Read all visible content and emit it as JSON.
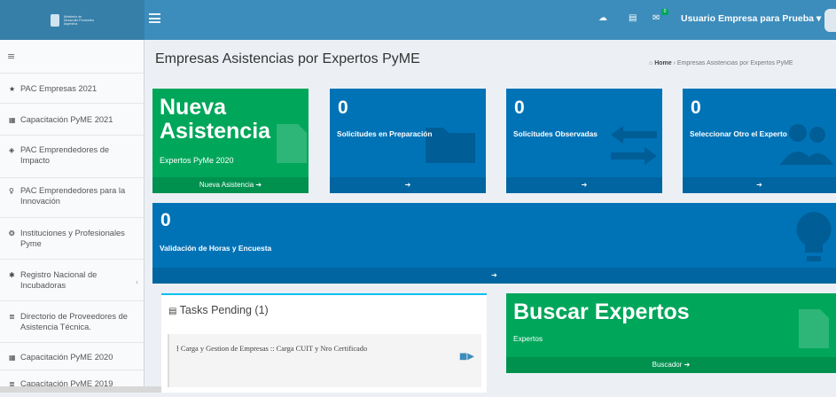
{
  "topbar": {
    "logo_text": [
      "Ministerio de",
      "Desarrollo Productivo",
      "Argentina"
    ],
    "user_label": "Usuario Empresa para Prueba ▾",
    "mail_badge": "0"
  },
  "sidebar": {
    "items": [
      {
        "icon": "★",
        "label": "PAC Empresas 2021"
      },
      {
        "icon": "▦",
        "label": "Capacitación PyME 2021"
      },
      {
        "icon": "◈",
        "label": "PAC Emprendedores de Impacto"
      },
      {
        "icon": "♀",
        "label": "PAC Emprendedores para la Innovación"
      },
      {
        "icon": "❂",
        "label": "Instituciones y Profesionales Pyme"
      },
      {
        "icon": "✱",
        "label": "Registro Nacional de Incubadoras"
      },
      {
        "icon": "≣",
        "label": "Directorio de Proveedores de Asistencia Técnica."
      },
      {
        "icon": "▦",
        "label": "Capacitación PyME 2020"
      },
      {
        "icon": "≣",
        "label": "Capacitación PyME 2019"
      }
    ]
  },
  "header": {
    "title": "Empresas Asistencias por Expertos PyME",
    "breadcrumb_home": "Home",
    "breadcrumb_current": "Empresas Asistencias por Expertos PyME"
  },
  "boxes": {
    "nueva": {
      "title": "Nueva Asistencia",
      "subtitle": "Expertos PyMe 2020",
      "footer": "Nueva Asistencia ➔"
    },
    "preparacion": {
      "value": "0",
      "label": "Solicitudes en Preparación",
      "footer": "➔"
    },
    "observadas": {
      "value": "0",
      "label": "Solicitudes Observadas",
      "footer": "➔"
    },
    "otro_experto": {
      "value": "0",
      "label": "Seleccionar Otro el Experto",
      "footer": "➔"
    },
    "validacion": {
      "value": "0",
      "label": "Validación de Horas y Encuesta",
      "footer": "➔"
    },
    "buscar": {
      "title": "Buscar Expertos",
      "subtitle": "Expertos",
      "footer": "Buscador ➔"
    }
  },
  "tasks": {
    "header": "Tasks Pending (1)",
    "items": [
      {
        "text": "Carga y Gestion de Empresas :: Carga CUIT y Nro Certificado"
      }
    ]
  },
  "colors": {
    "topbar": "#3c8dbc",
    "green": "#00a65a",
    "blue": "#0073b7"
  }
}
